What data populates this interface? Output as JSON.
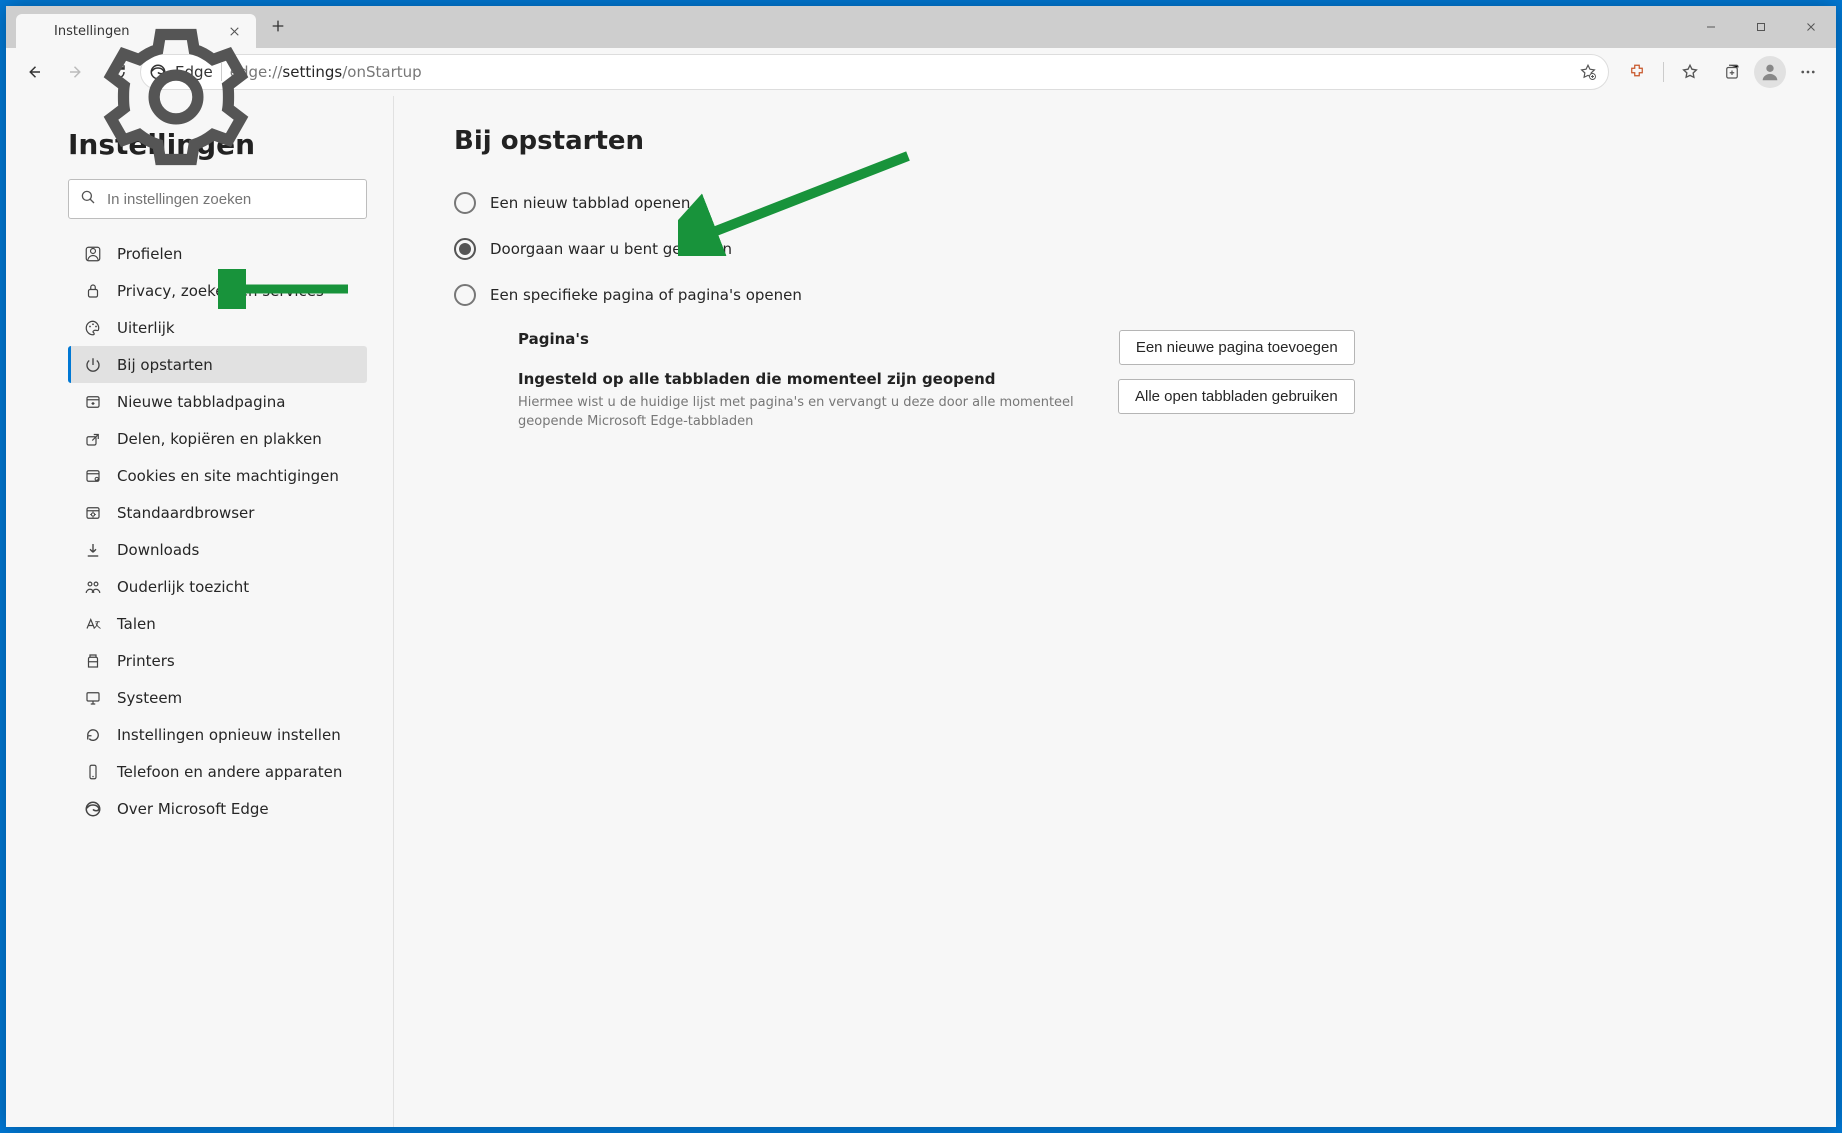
{
  "tab": {
    "title": "Instellingen"
  },
  "toolbar": {
    "identity_label": "Edge",
    "url_prefix": "edge://",
    "url_mid": "settings",
    "url_suffix": "/onStartup"
  },
  "sidebar": {
    "heading": "Instellingen",
    "search_placeholder": "In instellingen zoeken",
    "items": [
      {
        "label": "Profielen",
        "icon": "profile-icon"
      },
      {
        "label": "Privacy, zoeken en services",
        "icon": "lock-icon"
      },
      {
        "label": "Uiterlijk",
        "icon": "appearance-icon"
      },
      {
        "label": "Bij opstarten",
        "icon": "power-icon",
        "selected": true
      },
      {
        "label": "Nieuwe tabbladpagina",
        "icon": "newtab-icon"
      },
      {
        "label": "Delen, kopiëren en plakken",
        "icon": "share-icon"
      },
      {
        "label": "Cookies en site machtigingen",
        "icon": "permissions-icon"
      },
      {
        "label": "Standaardbrowser",
        "icon": "default-browser-icon"
      },
      {
        "label": "Downloads",
        "icon": "download-icon"
      },
      {
        "label": "Ouderlijk toezicht",
        "icon": "family-icon"
      },
      {
        "label": "Talen",
        "icon": "language-icon"
      },
      {
        "label": "Printers",
        "icon": "printer-icon"
      },
      {
        "label": "Systeem",
        "icon": "system-icon"
      },
      {
        "label": "Instellingen opnieuw instellen",
        "icon": "reset-icon"
      },
      {
        "label": "Telefoon en andere apparaten",
        "icon": "phone-icon"
      },
      {
        "label": "Over Microsoft Edge",
        "icon": "edge-icon"
      }
    ]
  },
  "main": {
    "heading": "Bij opstarten",
    "options": [
      {
        "label": "Een nieuw tabblad openen",
        "checked": false
      },
      {
        "label": "Doorgaan waar u bent gebleven",
        "checked": true
      },
      {
        "label": "Een specifieke pagina of pagina's openen",
        "checked": false
      }
    ],
    "pages_heading": "Pagina's",
    "use_open_heading": "Ingesteld op alle tabbladen die momenteel zijn geopend",
    "use_open_desc": "Hiermee wist u de huidige lijst met pagina's en vervangt u deze door alle momenteel geopende Microsoft Edge-tabbladen",
    "buttons": {
      "add_page": "Een nieuwe pagina toevoegen",
      "use_open_tabs": "Alle open tabbladen gebruiken"
    }
  }
}
